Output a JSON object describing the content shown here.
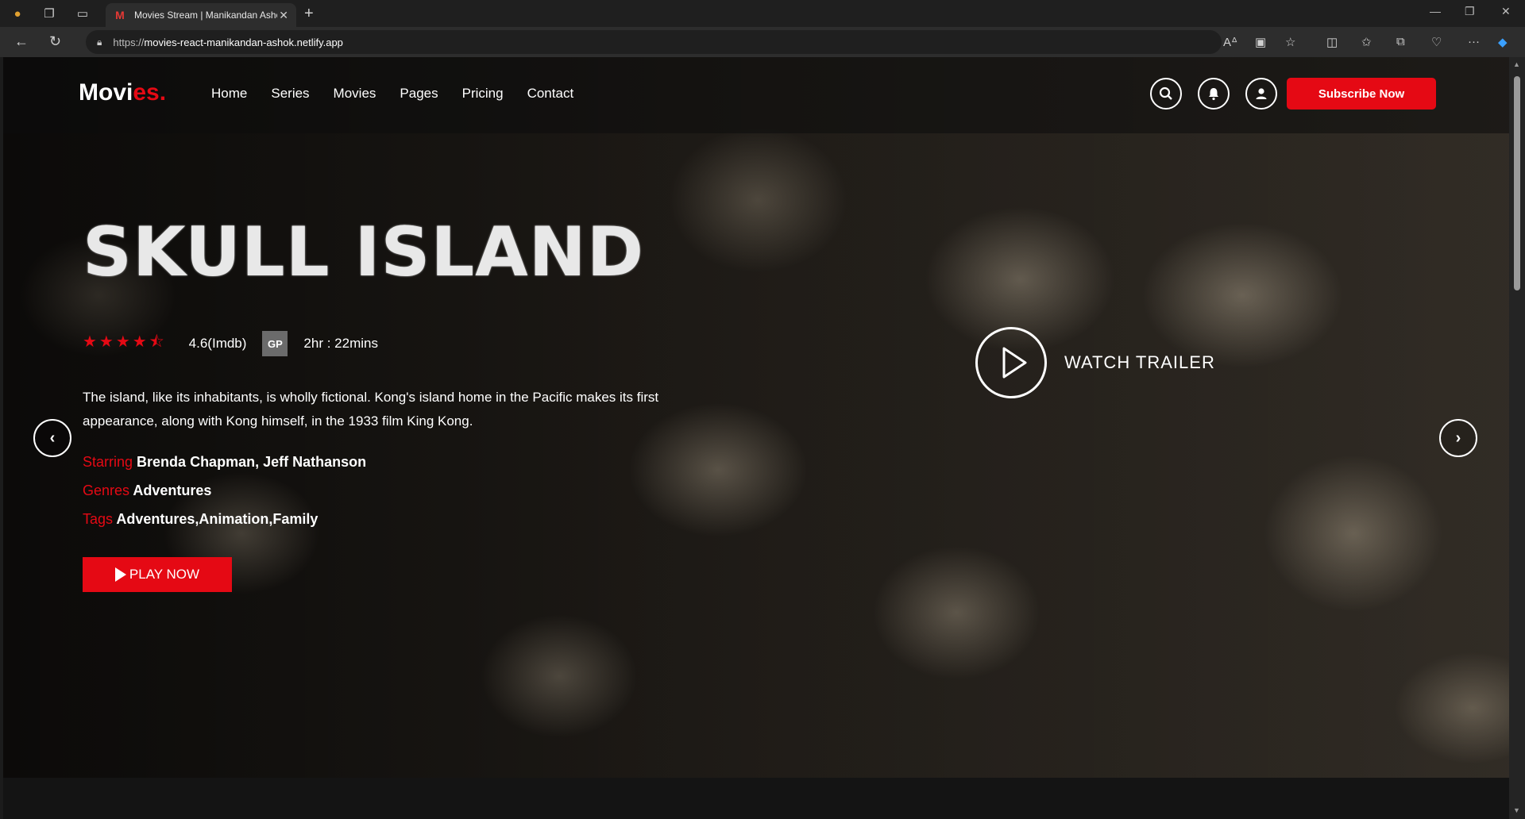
{
  "browser": {
    "tab_title": "Movies Stream | Manikandan Ashok",
    "url_prefix": "https://",
    "url_host": "movies-react-manikandan-ashok.netlify.app"
  },
  "site": {
    "logo_main": "Movi",
    "logo_accent": "es.",
    "nav": [
      "Home",
      "Series",
      "Movies",
      "Pages",
      "Pricing",
      "Contact"
    ],
    "subscribe_label": "Subscribe Now"
  },
  "hero": {
    "title": "SKULL ISLAND",
    "rating": 4.6,
    "rating_text": "4.6(Imdb)",
    "badge": "GP",
    "duration": "2hr : 22mins",
    "description": "The island, like its inhabitants, is wholly fictional. Kong's island home in the Pacific makes its first appearance, along with Kong himself, in the 1933 film King Kong.",
    "starring_label": "Starring",
    "starring": "Brenda Chapman, Jeff Nathanson",
    "genres_label": "Genres",
    "genres": "Adventures",
    "tags_label": "Tags",
    "tags": "Adventures,Animation,Family",
    "play_label": "PLAY NOW",
    "trailer_label": "WATCH TRAILER"
  },
  "colors": {
    "accent": "#e50914",
    "badge": "#6b6b6b",
    "background": "#141414"
  }
}
